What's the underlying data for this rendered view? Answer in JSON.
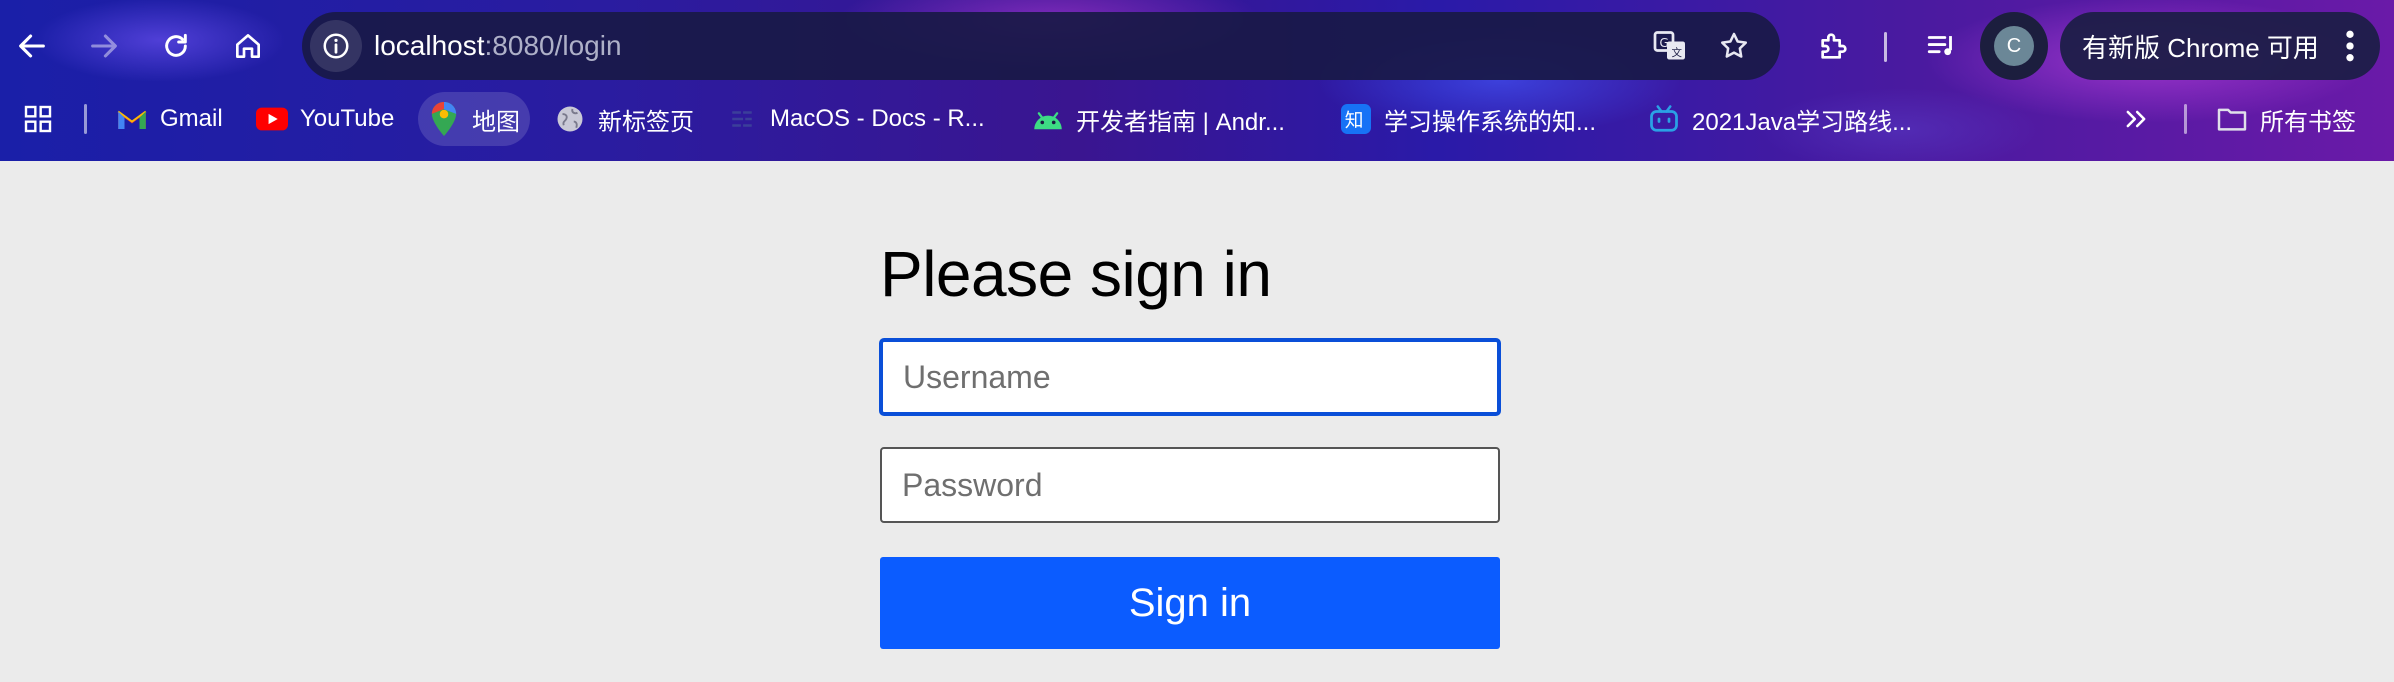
{
  "browser": {
    "url_host": "localhost",
    "url_rest": ":8080/login",
    "update_label": "有新版 Chrome 可用",
    "avatar_letter": "C"
  },
  "bookmarks": [
    {
      "label": "Gmail",
      "icon": "gmail-icon"
    },
    {
      "label": "YouTube",
      "icon": "youtube-icon"
    },
    {
      "label": "地图",
      "icon": "maps-icon"
    },
    {
      "label": "新标签页",
      "icon": "globe-icon"
    },
    {
      "label": "MacOS - Docs - R...",
      "icon": "docs-icon"
    },
    {
      "label": "开发者指南 | Andr...",
      "icon": "android-icon"
    },
    {
      "label": "学习操作系统的知...",
      "icon": "zhihu-icon"
    },
    {
      "label": "2021Java学习路线...",
      "icon": "bilibili-icon"
    },
    {
      "label": "所有书签",
      "icon": "folder-icon"
    }
  ],
  "login": {
    "title": "Please sign in",
    "username_placeholder": "Username",
    "password_placeholder": "Password",
    "submit_label": "Sign in"
  },
  "colors": {
    "primary_button": "#0b5cff",
    "focus_border": "#0a4fd8",
    "page_background": "#ebebeb"
  }
}
